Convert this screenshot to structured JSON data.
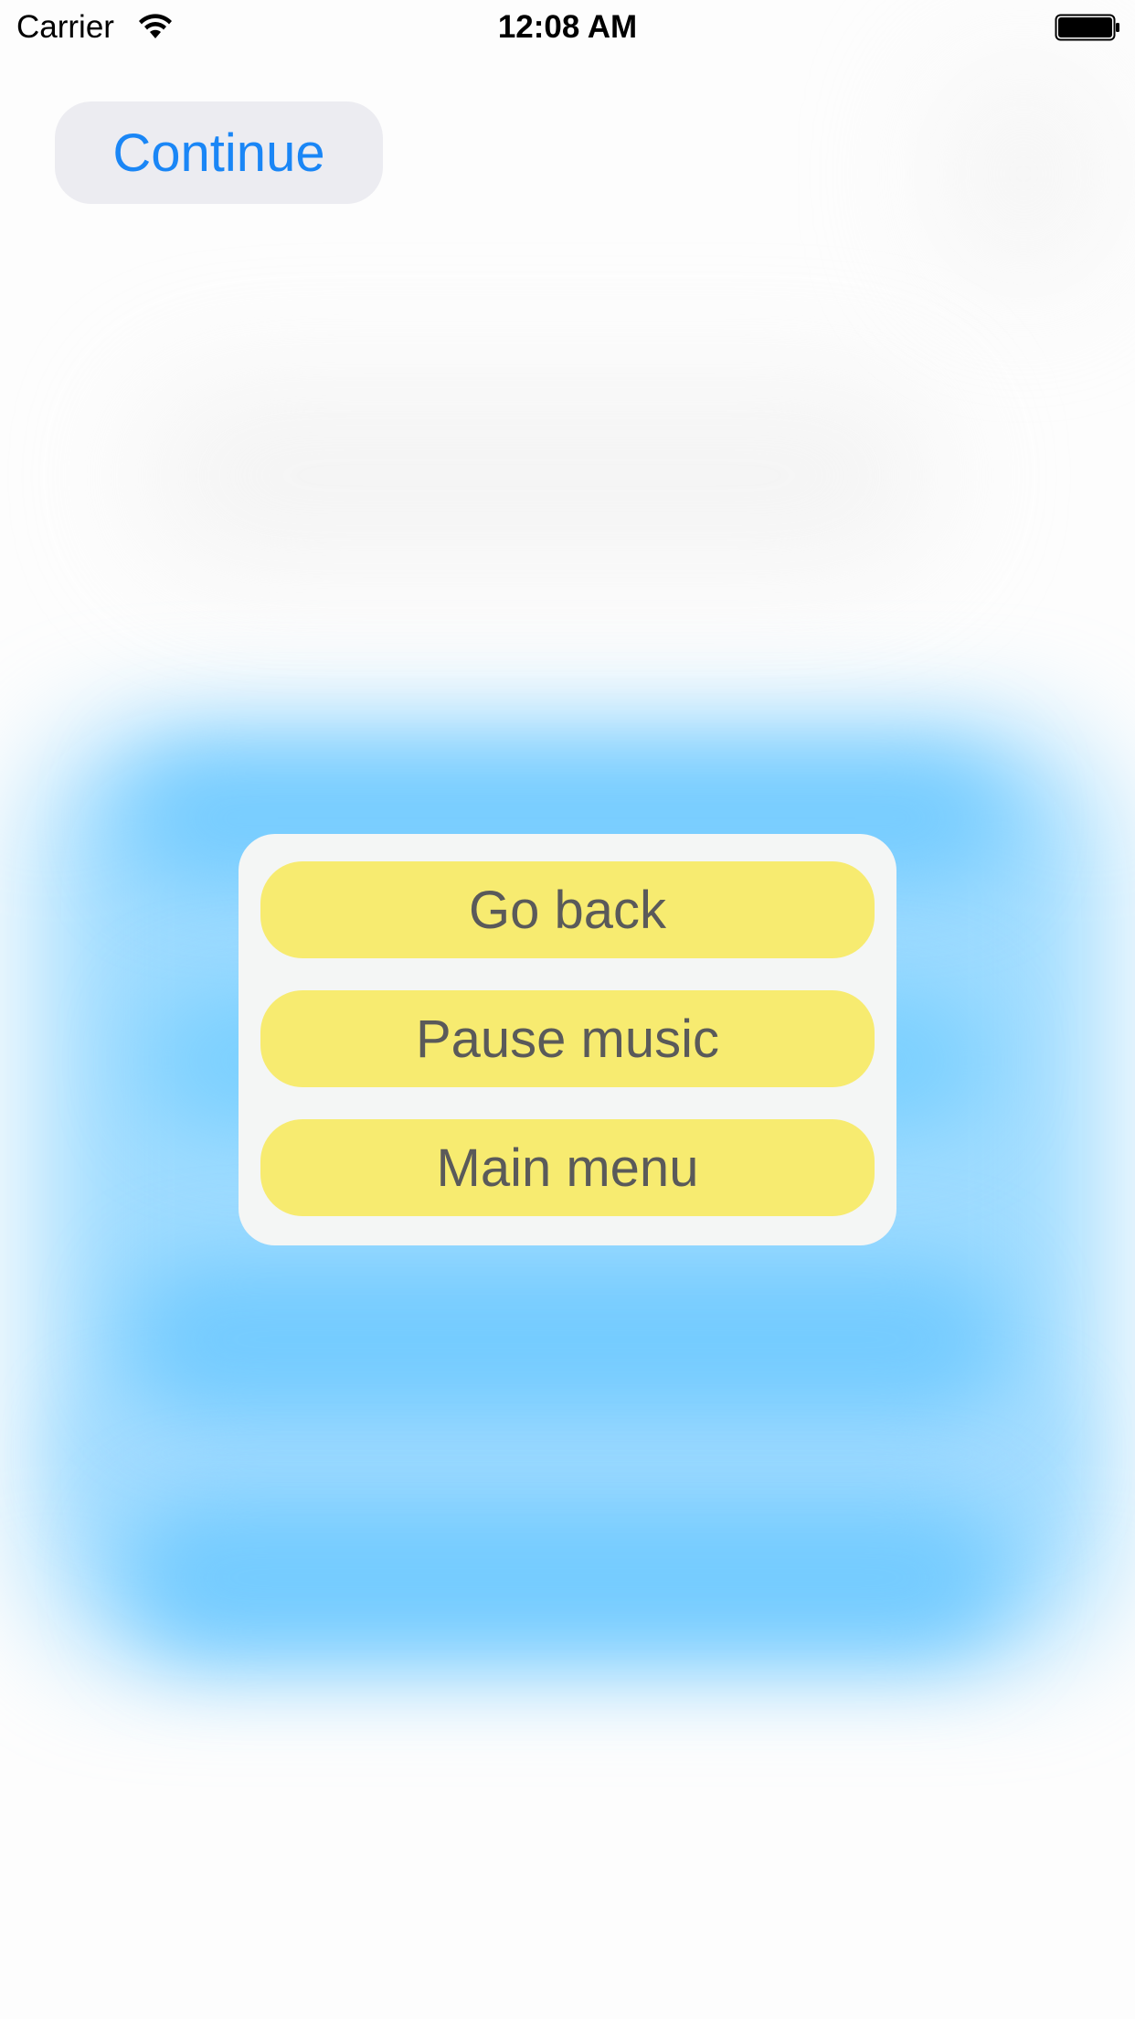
{
  "status_bar": {
    "carrier": "Carrier",
    "time": "12:08 AM",
    "wifi_icon": "wifi-icon",
    "battery_icon": "battery-full-icon"
  },
  "continue_button": {
    "label": "Continue",
    "color": "#1a86f6"
  },
  "menu": {
    "items": [
      {
        "label": "Go back"
      },
      {
        "label": "Pause music"
      },
      {
        "label": "Main menu"
      }
    ],
    "button_color": "#f7eb70",
    "panel_color": "#f4f6f5"
  },
  "colors": {
    "background_blur_blue": "#7ccfff"
  }
}
